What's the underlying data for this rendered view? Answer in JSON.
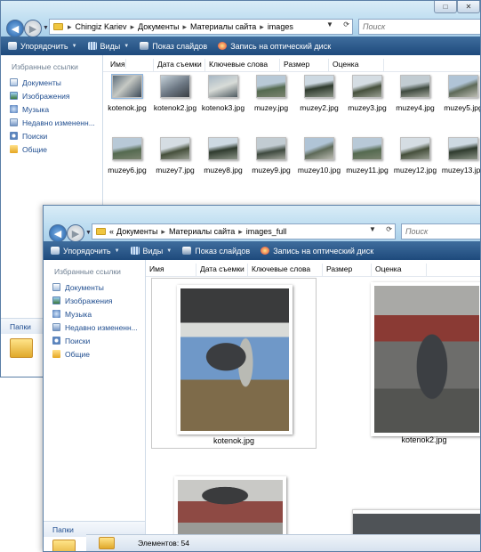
{
  "window_back": {
    "address": {
      "crumbs": [
        "Chingiz Kariev",
        "Документы",
        "Материалы сайта",
        "images"
      ]
    },
    "search_placeholder": "Поиск",
    "toolbar": {
      "organize": "Упорядочить",
      "views": "Виды",
      "slideshow": "Показ слайдов",
      "burn": "Запись на оптический диск"
    },
    "sidebar": {
      "title": "Избранные ссылки",
      "items": [
        "Документы",
        "Изображения",
        "Музыка",
        "Недавно измененн...",
        "Поиски",
        "Общие"
      ],
      "folders_label": "Папки"
    },
    "columns": [
      "Имя",
      "Дата съемки",
      "Ключевые слова",
      "Размер",
      "Оценка"
    ],
    "files_row1": [
      "kotenok.jpg",
      "kotenok2.jpg",
      "kotenok3.jpg",
      "muzey.jpg",
      "muzey2.jpg",
      "muzey3.jpg",
      "muzey4.jpg",
      "muzey5.jpg"
    ],
    "files_row2": [
      "muzey6.jpg",
      "muzey7.jpg",
      "muzey8.jpg",
      "muzey9.jpg",
      "muzey10.jpg",
      "muzey11.jpg",
      "muzey12.jpg",
      "muzey13.jpg"
    ]
  },
  "window_front": {
    "address": {
      "prefix": "«",
      "crumbs": [
        "Документы",
        "Материалы сайта",
        "images_full"
      ]
    },
    "search_placeholder": "Поиск",
    "toolbar": {
      "organize": "Упорядочить",
      "views": "Виды",
      "slideshow": "Показ слайдов",
      "burn": "Запись на оптический диск"
    },
    "sidebar": {
      "title": "Избранные ссылки",
      "items": [
        "Документы",
        "Изображения",
        "Музыка",
        "Недавно измененн...",
        "Поиски",
        "Общие"
      ],
      "folders_label": "Папки"
    },
    "columns": [
      "Имя",
      "Дата съемки",
      "Ключевые слова",
      "Размер",
      "Оценка"
    ],
    "files": [
      "kotenok.jpg",
      "kotenok2.jpg"
    ],
    "status": "Элементов: 54"
  }
}
